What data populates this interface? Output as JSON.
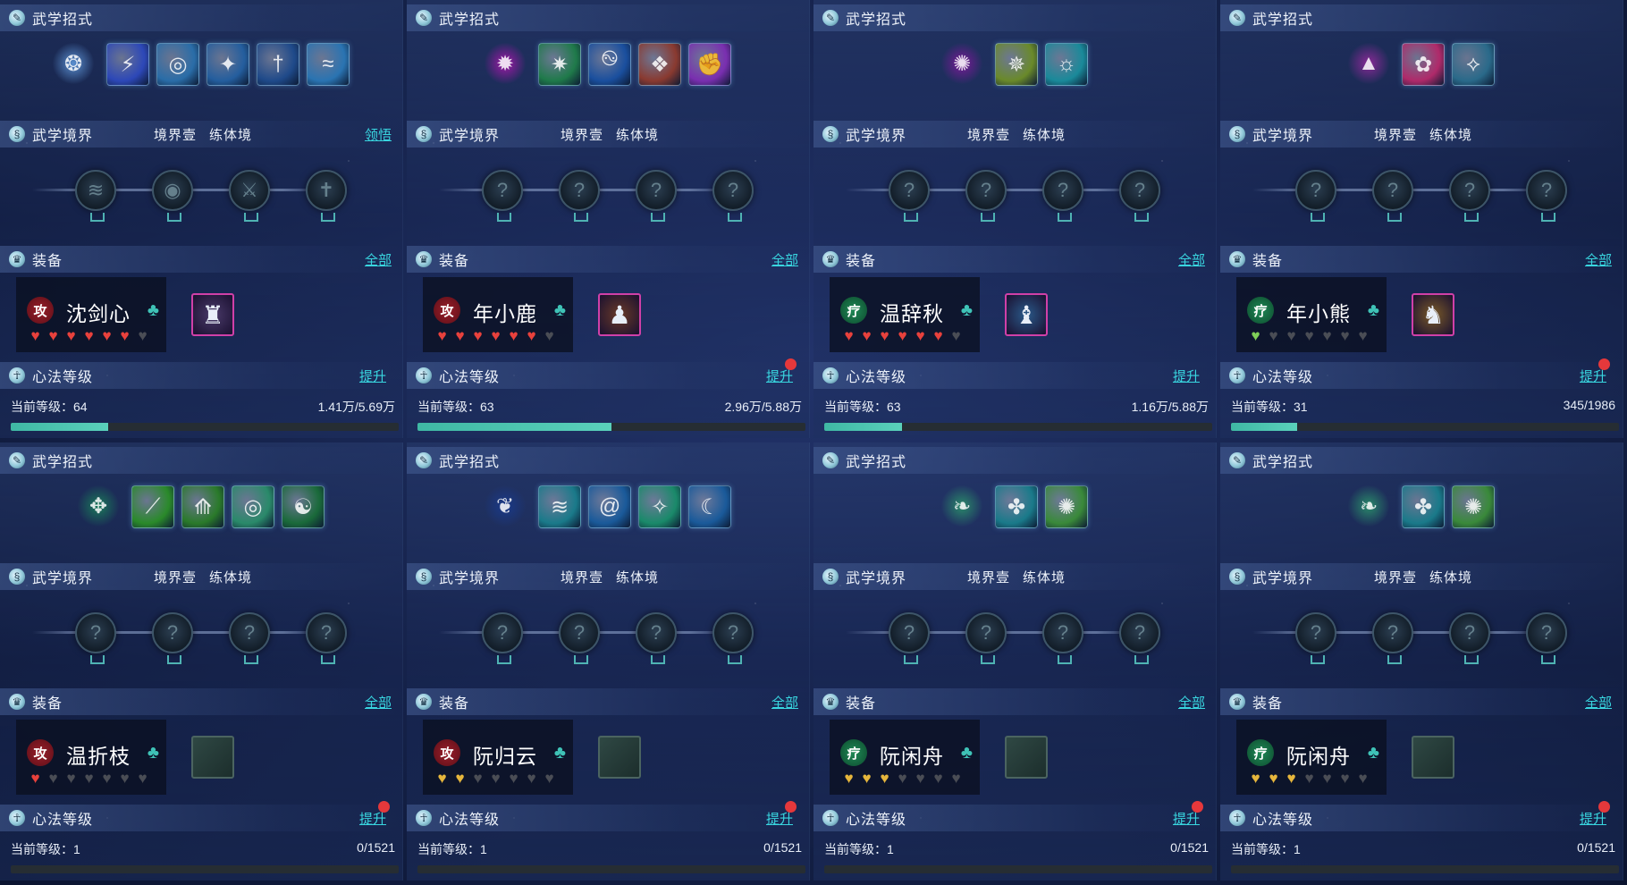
{
  "labels": {
    "skills_title": "武学招式",
    "realm_title": "武学境界",
    "realm_level": "境界壹",
    "realm_stage": "练体境",
    "equip_title": "装备",
    "equip_all": "全部",
    "xinfa_title": "心法等级",
    "xinfa_upgrade": "提升",
    "current_level_prefix": "当前等级："
  },
  "colors": {
    "link": "#39d6e0",
    "alert_dot": "#e5383b",
    "progress": "#3fb8a4"
  },
  "panels": [
    {
      "realm_action": "领悟",
      "name": "沈剑心",
      "role": "攻",
      "hearts": [
        "red",
        "red",
        "red",
        "red",
        "red",
        "half",
        "empty"
      ],
      "level": "64",
      "exp": "1.41万/5.69万",
      "progress": 0.25,
      "upgrade_dot": false,
      "skills": [
        {
          "icon": "frost-orb-icon",
          "glyph": "❂",
          "bg": "#5a8fd0"
        },
        {
          "icon": "lightning-slash-icon",
          "glyph": "⚡",
          "bg": "#2d48b8"
        },
        {
          "icon": "whirl-icon",
          "glyph": "◎",
          "bg": "#2a6da8"
        },
        {
          "icon": "ice-claw-icon",
          "glyph": "✦",
          "bg": "#245e9e"
        },
        {
          "icon": "sword-fall-icon",
          "glyph": "†",
          "bg": "#1f4a8a"
        },
        {
          "icon": "wave-strike-icon",
          "glyph": "≈",
          "bg": "#2a74b2"
        }
      ],
      "nodes": [
        {
          "icon": "wind-node-icon",
          "glyph": "≋"
        },
        {
          "icon": "vortex-node-icon",
          "glyph": "◉"
        },
        {
          "icon": "blade-node-icon",
          "glyph": "⚔"
        },
        {
          "icon": "sword-node-icon",
          "glyph": "✝"
        }
      ],
      "gear": {
        "icon": "armor-robot-icon",
        "glyph": "♜",
        "bg": "#4a3a6a"
      }
    },
    {
      "realm_action": "",
      "name": "年小鹿",
      "role": "攻",
      "hearts": [
        "red",
        "red",
        "red",
        "red",
        "red",
        "red",
        "empty"
      ],
      "level": "63",
      "exp": "2.96万/5.88万",
      "progress": 0.5,
      "upgrade_dot": true,
      "skills": [
        {
          "icon": "magenta-orb-icon",
          "glyph": "✹",
          "bg": "#a018a8"
        },
        {
          "icon": "green-spark-icon",
          "glyph": "✷",
          "bg": "#1f7a4a"
        },
        {
          "icon": "blue-spiral-icon",
          "glyph": "࿊",
          "bg": "#1a4f9e"
        },
        {
          "icon": "beast-icon",
          "glyph": "❖",
          "bg": "#8a3a30"
        },
        {
          "icon": "purple-fist-icon",
          "glyph": "✊",
          "bg": "#7a2fb0"
        }
      ],
      "nodes": [
        {
          "icon": "locked-node-icon",
          "glyph": "?"
        },
        {
          "icon": "locked-node-icon",
          "glyph": "?"
        },
        {
          "icon": "locked-node-icon",
          "glyph": "?"
        },
        {
          "icon": "locked-node-icon",
          "glyph": "?"
        }
      ],
      "gear": {
        "icon": "fur-armor-icon",
        "glyph": "♟",
        "bg": "#6a3a28"
      }
    },
    {
      "realm_action": "",
      "name": "温辞秋",
      "role": "疗",
      "hearts": [
        "red",
        "red",
        "red",
        "red",
        "red",
        "red",
        "empty"
      ],
      "level": "63",
      "exp": "1.16万/5.88万",
      "progress": 0.2,
      "upgrade_dot": false,
      "skills": [
        {
          "icon": "dancer-icon",
          "glyph": "✺",
          "bg": "#7a1a98"
        },
        {
          "icon": "golden-burst-icon",
          "glyph": "✵",
          "bg": "#6a8a2a"
        },
        {
          "icon": "sun-ring-icon",
          "glyph": "☼",
          "bg": "#1a8a9a"
        }
      ],
      "nodes": [
        {
          "icon": "locked-node-icon",
          "glyph": "?"
        },
        {
          "icon": "locked-node-icon",
          "glyph": "?"
        },
        {
          "icon": "locked-node-icon",
          "glyph": "?"
        },
        {
          "icon": "locked-node-icon",
          "glyph": "?"
        }
      ],
      "gear": {
        "icon": "robe-armor-icon",
        "glyph": "♝",
        "bg": "#2a5a8a"
      }
    },
    {
      "realm_action": "",
      "name": "年小熊",
      "role": "疗",
      "hearts": [
        "green",
        "empty",
        "empty",
        "empty",
        "empty",
        "empty",
        "empty"
      ],
      "level": "31",
      "exp": "345/1986",
      "progress": 0.17,
      "upgrade_dot": true,
      "skills": [
        {
          "icon": "crystal-spire-icon",
          "glyph": "▲",
          "bg": "#8a2a98"
        },
        {
          "icon": "pink-beast-icon",
          "glyph": "✿",
          "bg": "#b02a6a"
        },
        {
          "icon": "fang-icon",
          "glyph": "⟡",
          "bg": "#2a6a8a"
        }
      ],
      "nodes": [
        {
          "icon": "locked-node-icon",
          "glyph": "?"
        },
        {
          "icon": "locked-node-icon",
          "glyph": "?"
        },
        {
          "icon": "locked-node-icon",
          "glyph": "?"
        },
        {
          "icon": "locked-node-icon",
          "glyph": "?"
        }
      ],
      "gear": {
        "icon": "golden-armor-icon",
        "glyph": "♞",
        "bg": "#7a5a28"
      }
    },
    {
      "realm_action": "",
      "name": "温折枝",
      "role": "攻",
      "hearts": [
        "half",
        "empty",
        "empty",
        "empty",
        "empty",
        "empty",
        "empty"
      ],
      "level": "1",
      "exp": "0/1521",
      "progress": 0,
      "upgrade_dot": true,
      "skills": [
        {
          "icon": "green-warrior-icon",
          "glyph": "✥",
          "bg": "#1a7a5a"
        },
        {
          "icon": "leaf-slash-icon",
          "glyph": "⟋",
          "bg": "#2a8a2a"
        },
        {
          "icon": "claw-icon",
          "glyph": "⟰",
          "bg": "#2a7a2a"
        },
        {
          "icon": "ring-icon",
          "glyph": "◎",
          "bg": "#2a8a6a"
        },
        {
          "icon": "taiji-icon",
          "glyph": "☯",
          "bg": "#1a6a3a"
        }
      ],
      "nodes": [
        {
          "icon": "locked-node-icon",
          "glyph": "?"
        },
        {
          "icon": "locked-node-icon",
          "glyph": "?"
        },
        {
          "icon": "locked-node-icon",
          "glyph": "?"
        },
        {
          "icon": "locked-node-icon",
          "glyph": "?"
        }
      ],
      "gear": {
        "icon": "empty-slot-icon",
        "glyph": "",
        "bg": ""
      }
    },
    {
      "realm_action": "",
      "name": "阮归云",
      "role": "攻",
      "hearts": [
        "gold",
        "gold",
        "empty",
        "empty",
        "empty",
        "empty",
        "empty"
      ],
      "level": "1",
      "exp": "0/1521",
      "progress": 0,
      "upgrade_dot": true,
      "skills": [
        {
          "icon": "blue-flame-icon",
          "glyph": "❦",
          "bg": "#1a3a8a"
        },
        {
          "icon": "wave-slash-icon",
          "glyph": "≋",
          "bg": "#1a7a8a"
        },
        {
          "icon": "cyclone-icon",
          "glyph": "@",
          "bg": "#1a5a9a"
        },
        {
          "icon": "star-strike-icon",
          "glyph": "✧",
          "bg": "#1a8a6a"
        },
        {
          "icon": "crescent-icon",
          "glyph": "☾",
          "bg": "#1a5a9a"
        }
      ],
      "nodes": [
        {
          "icon": "locked-node-icon",
          "glyph": "?"
        },
        {
          "icon": "locked-node-icon",
          "glyph": "?"
        },
        {
          "icon": "locked-node-icon",
          "glyph": "?"
        },
        {
          "icon": "locked-node-icon",
          "glyph": "?"
        }
      ],
      "gear": {
        "icon": "empty-slot-icon",
        "glyph": "",
        "bg": ""
      }
    },
    {
      "realm_action": "",
      "name": "阮闲舟",
      "role": "疗",
      "hearts": [
        "gold",
        "gold",
        "gold",
        "empty",
        "empty",
        "empty",
        "empty"
      ],
      "level": "1",
      "exp": "0/1521",
      "progress": 0,
      "upgrade_dot": true,
      "skills": [
        {
          "icon": "jade-leaf-icon",
          "glyph": "❧",
          "bg": "#2a8a6a"
        },
        {
          "icon": "fish-icon",
          "glyph": "✤",
          "bg": "#1a7a8a"
        },
        {
          "icon": "flower-burst-icon",
          "glyph": "✺",
          "bg": "#3a8a3a"
        }
      ],
      "nodes": [
        {
          "icon": "locked-node-icon",
          "glyph": "?"
        },
        {
          "icon": "locked-node-icon",
          "glyph": "?"
        },
        {
          "icon": "locked-node-icon",
          "glyph": "?"
        },
        {
          "icon": "locked-node-icon",
          "glyph": "?"
        }
      ],
      "gear": {
        "icon": "empty-slot-icon",
        "glyph": "",
        "bg": ""
      }
    },
    {
      "realm_action": "",
      "name": "阮闲舟",
      "role": "疗",
      "hearts": [
        "gold",
        "gold",
        "gold",
        "empty",
        "empty",
        "empty",
        "empty"
      ],
      "level": "1",
      "exp": "0/1521",
      "progress": 0,
      "upgrade_dot": true,
      "skills": [
        {
          "icon": "jade-leaf-icon",
          "glyph": "❧",
          "bg": "#2a8a6a"
        },
        {
          "icon": "fish-icon",
          "glyph": "✤",
          "bg": "#1a7a8a"
        },
        {
          "icon": "flower-burst-icon",
          "glyph": "✺",
          "bg": "#3a8a3a"
        }
      ],
      "nodes": [
        {
          "icon": "locked-node-icon",
          "glyph": "?"
        },
        {
          "icon": "locked-node-icon",
          "glyph": "?"
        },
        {
          "icon": "locked-node-icon",
          "glyph": "?"
        },
        {
          "icon": "locked-node-icon",
          "glyph": "?"
        }
      ],
      "gear": {
        "icon": "empty-slot-icon",
        "glyph": "",
        "bg": ""
      }
    }
  ]
}
